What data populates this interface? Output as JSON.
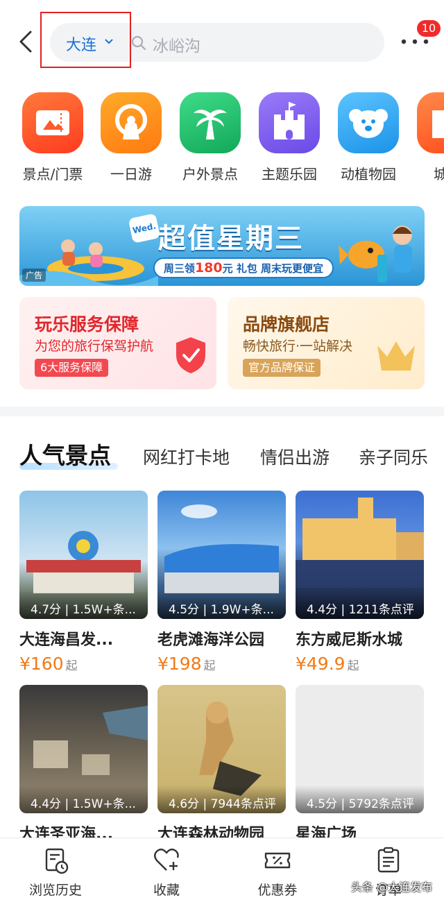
{
  "header": {
    "city": "大连",
    "search_placeholder": "冰峪沟",
    "notification_count": "10"
  },
  "categories": [
    {
      "label": "景点/门票",
      "icon": "ticket-icon",
      "color": "#ff5a2a"
    },
    {
      "label": "一日游",
      "icon": "ferris-wheel-icon",
      "color": "#ff8a1a"
    },
    {
      "label": "户外景点",
      "icon": "palm-tree-icon",
      "color": "#20c06a"
    },
    {
      "label": "主题乐园",
      "icon": "castle-icon",
      "color": "#7b5cf0"
    },
    {
      "label": "动植物园",
      "icon": "koala-icon",
      "color": "#2aa6f2"
    },
    {
      "label": "城市",
      "icon": "building-icon",
      "color": "#ff6a2a"
    }
  ],
  "banner": {
    "badge": "Wed.",
    "title": "超值星期三",
    "strip_prefix": "周三领",
    "strip_amount": "180",
    "strip_suffix": "元 礼包 周末玩更便宜",
    "ad_tag": "广告"
  },
  "promos": [
    {
      "title": "玩乐服务保障",
      "subtitle": "为您的旅行保驾护航",
      "chip": "6大服务保障"
    },
    {
      "title": "品牌旗舰店",
      "subtitle": "畅快旅行·一站解决",
      "chip": "官方品牌保证"
    }
  ],
  "tabs": [
    "人气景点",
    "网红打卡地",
    "情侣出游",
    "亲子同乐"
  ],
  "cards": [
    {
      "name": "大连海昌发...",
      "meta": "4.7分 | 1.5W+条...",
      "price": "¥160",
      "suffix": "起"
    },
    {
      "name": "老虎滩海洋公园",
      "meta": "4.5分 | 1.9W+条...",
      "price": "¥198",
      "suffix": "起"
    },
    {
      "name": "东方威尼斯水城",
      "meta": "4.4分 | 1211条点评",
      "price": "¥49.9",
      "suffix": "起"
    },
    {
      "name": "大连圣亚海...",
      "meta": "4.4分 | 1.5W+条...",
      "price": "",
      "suffix": ""
    },
    {
      "name": "大连森林动物园",
      "meta": "4.6分 | 7944条点评",
      "price": "",
      "suffix": ""
    },
    {
      "name": "星海广场",
      "meta": "4.5分 | 5792条点评",
      "price": "",
      "suffix": ""
    }
  ],
  "bottom_nav": [
    {
      "label": "浏览历史",
      "icon": "history-icon"
    },
    {
      "label": "收藏",
      "icon": "heart-plus-icon"
    },
    {
      "label": "优惠券",
      "icon": "coupon-icon"
    },
    {
      "label": "订单",
      "icon": "order-icon"
    }
  ],
  "watermark": "头条 @大连发布"
}
